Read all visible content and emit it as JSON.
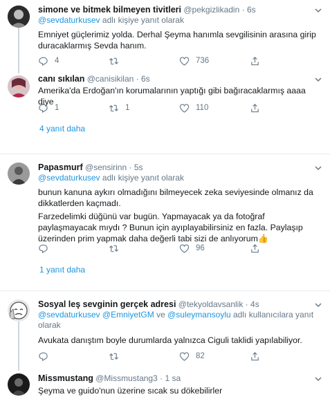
{
  "tweets": [
    {
      "name": "simone ve bitmek bilmeyen tivitleri",
      "handle": "@pekgizlikadin",
      "dot": "·",
      "time": "6s",
      "reply_prefix": "@sevdaturkusev",
      "reply_suffix": " adlı kişiye yanıt olarak",
      "text": "Emniyet güçlerimiz yolda. Derhal Şeyma hanımla sevgilisinin arasına girip duracaklarmış Sevda hanım.",
      "replies": "4",
      "retweets": "",
      "likes": "736"
    },
    {
      "name": "canı sıkılan",
      "handle": "@canisikilan",
      "dot": "·",
      "time": "6s",
      "text": "Amerika'da Erdoğan'ın korumalarının yaptığı gibi bağıracaklarmış aaaa diye",
      "replies": "1",
      "retweets": "1",
      "likes": "110"
    },
    {
      "name": "Papasmurf",
      "handle": "@sensirinn",
      "dot": "·",
      "time": "5s",
      "reply_prefix": "@sevdaturkusev",
      "reply_suffix": " adlı kişiye yanıt olarak",
      "text1": "bunun kanuna aykırı olmadığını bilmeyecek zeka seviyesinde olmanız da dikkatlerden kaçmadı.",
      "text2": "Farzedelimki düğünü var bugün. Yapmayacak ya da fotoğraf paylaşmayacak mıydı ? Bunun için ayıplayabilirsiniz en fazla. Paylaşıp üzerinden prim yapmak daha değerli tabi sizi de anlıyorum👍",
      "replies": "",
      "retweets": "",
      "likes": "96"
    },
    {
      "name": "Sosyal leş sevginin gerçek adresi",
      "handle": "@tekyoldavsanlik",
      "dot": "·",
      "time": "4s",
      "mentions": [
        "@sevdaturkusev",
        "@EmniyetGM",
        "@suleymansoylu"
      ],
      "ve": " ve ",
      "reply_suffix": " adlı kullanıcılara yanıt olarak",
      "text": "Avukata danıştım boyle durumlarda yalnızca Ciguli taklidi yapılabiliyor.",
      "replies": "",
      "retweets": "",
      "likes": "82"
    },
    {
      "name": "Missmustang",
      "handle": "@Missmustang3",
      "dot": "·",
      "time": "1 sa",
      "text": "Şeyma ve guido'nun üzerine sıcak su dökebilirler"
    }
  ],
  "more_replies_1": "4 yanıt daha",
  "more_replies_2": "1 yanıt daha"
}
